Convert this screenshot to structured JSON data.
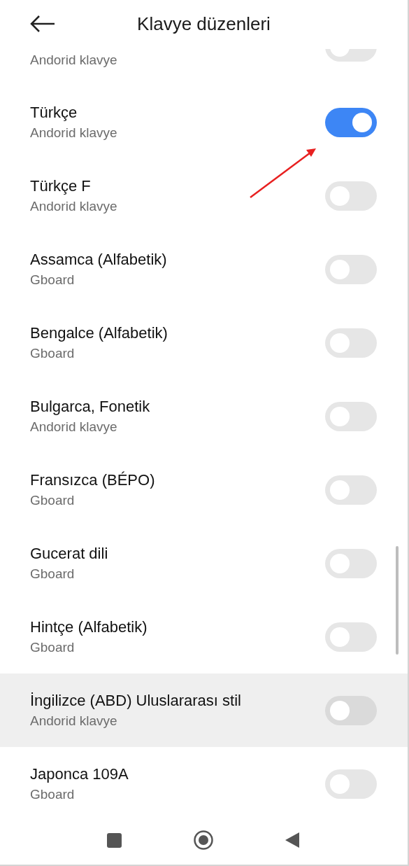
{
  "header": {
    "title": "Klavye düzenleri"
  },
  "layouts": [
    {
      "subtitle": "Andorid klavye",
      "on": false,
      "highlighted": false
    },
    {
      "title": "Türkçe",
      "subtitle": "Andorid klavye",
      "on": true,
      "highlighted": false
    },
    {
      "title": "Türkçe F",
      "subtitle": "Andorid klavye",
      "on": false,
      "highlighted": false
    },
    {
      "title": "Assamca (Alfabetik)",
      "subtitle": "Gboard",
      "on": false,
      "highlighted": false
    },
    {
      "title": "Bengalce (Alfabetik)",
      "subtitle": "Gboard",
      "on": false,
      "highlighted": false
    },
    {
      "title": "Bulgarca, Fonetik",
      "subtitle": "Andorid klavye",
      "on": false,
      "highlighted": false
    },
    {
      "title": "Fransızca (BÉPO)",
      "subtitle": "Gboard",
      "on": false,
      "highlighted": false
    },
    {
      "title": "Gucerat dili",
      "subtitle": "Gboard",
      "on": false,
      "highlighted": false
    },
    {
      "title": "Hintçe (Alfabetik)",
      "subtitle": "Gboard",
      "on": false,
      "highlighted": false
    },
    {
      "title": "İngilizce (ABD) Uluslararası stil",
      "subtitle": "Andorid klavye",
      "on": false,
      "highlighted": true
    },
    {
      "title": "Japonca 109A",
      "subtitle": "Gboard",
      "on": false,
      "highlighted": false
    }
  ]
}
